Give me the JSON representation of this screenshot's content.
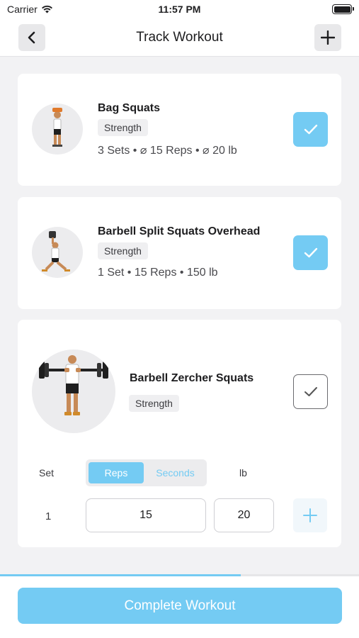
{
  "status_bar": {
    "carrier": "Carrier",
    "time": "11:57 PM"
  },
  "nav": {
    "title": "Track Workout",
    "back_icon": "chevron-left-icon",
    "add_icon": "plus-icon"
  },
  "exercises": [
    {
      "name": "Bag Squats",
      "tag": "Strength",
      "meta": "3 Sets • ⌀ 15 Reps • ⌀ 20 lb",
      "completed": true
    },
    {
      "name": "Barbell Split Squats Overhead",
      "tag": "Strength",
      "meta": "1 Set • 15 Reps • 150 lb",
      "completed": true
    },
    {
      "name": "Barbell Zercher Squats",
      "tag": "Strength",
      "completed": false,
      "columns": {
        "set": "Set",
        "reps_tab": "Reps",
        "seconds_tab": "Seconds",
        "weight": "lb"
      },
      "active_tab": "Reps",
      "sets": [
        {
          "set": "1",
          "reps": "15",
          "weight": "20"
        }
      ]
    }
  ],
  "progress": 0.67,
  "footer": {
    "complete_label": "Complete Workout"
  },
  "colors": {
    "accent": "#74cbf3",
    "background": "#f2f2f4",
    "card": "#ffffff"
  }
}
